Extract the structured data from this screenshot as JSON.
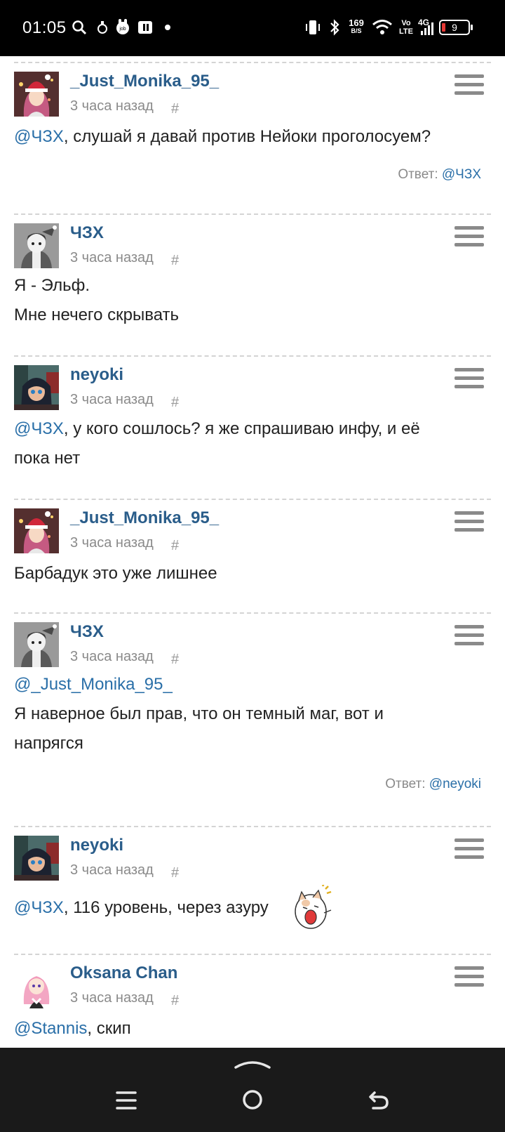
{
  "status_bar": {
    "time": "01:05",
    "net_speed_value": "169",
    "net_speed_unit": "B/S",
    "volte_top": "Vo",
    "volte_bottom": "LTE",
    "network": "4G",
    "battery": "9"
  },
  "comments": [
    {
      "author": "_Just_Monika_95_",
      "time": "3 часа назад",
      "hash": "#",
      "mention": "@ЧЗХ",
      "lines": [
        ", слушай я давай против Нейоки проголосуем?"
      ],
      "reply_label": "Ответ: ",
      "reply_to": "@ЧЗХ"
    },
    {
      "author": "ЧЗХ",
      "time": "3 часа назад",
      "hash": "#",
      "lines": [
        "Я - Эльф.",
        "Мне нечего скрывать"
      ]
    },
    {
      "author": "neyoki",
      "time": "3 часа назад",
      "hash": "#",
      "mention": "@ЧЗХ",
      "lines": [
        ", у кого сошлось? я же спрашиваю инфу, и её",
        "пока нет"
      ]
    },
    {
      "author": "_Just_Monika_95_",
      "time": "3 часа назад",
      "hash": "#",
      "lines": [
        "Барбадук это уже лишнее"
      ]
    },
    {
      "author": "ЧЗХ",
      "time": "3 часа назад",
      "hash": "#",
      "mention": "@_Just_Monika_95_",
      "lines": [
        "Я наверное был прав, что он темный маг, вот и",
        "напрягся"
      ],
      "reply_label": "Ответ: ",
      "reply_to": "@neyoki"
    },
    {
      "author": "neyoki",
      "time": "3 часа назад",
      "hash": "#",
      "mention": "@ЧЗХ",
      "lines": [
        ", 116 уровень, через азуру"
      ]
    },
    {
      "author": "Oksana Chan",
      "time": "3 часа назад",
      "hash": "#",
      "mention": "@Stannis",
      "lines": [
        ", скип"
      ]
    }
  ]
}
